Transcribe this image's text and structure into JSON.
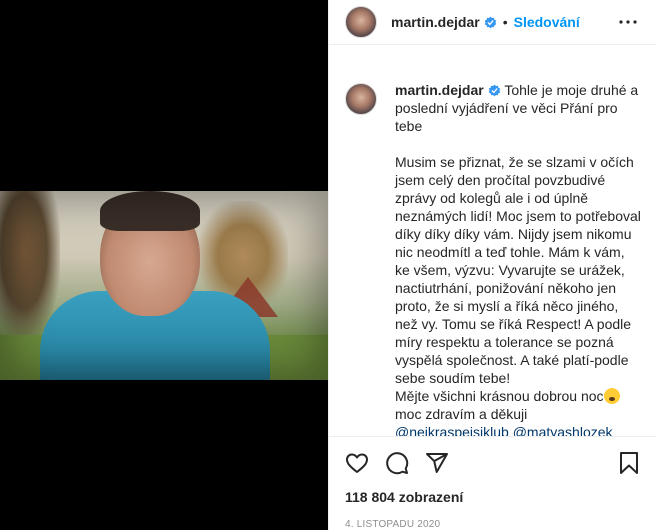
{
  "post": {
    "username": "martin.dejdar",
    "separator": "•",
    "follow_label": "Sledování",
    "caption_lines": [
      "Tohle je moje druhé a poslední vyjádření ve věci Přání pro tebe",
      "",
      "Musim se přiznat, že se slzami v očích jsem celý den pročítal povzbudivé zprávy od kolegů ale i od úplně neznámých lidí! Moc jsem to potřeboval díky díky díky vám. Nijdy jsem nikomu nic neodmítl a teď tohle. Mám k vám, ke všem, výzvu: Vyvarujte se urážek, nactiutrhání, ponižování někoho jen proto, že si myslí a říká něco jiného, než vy. Tomu se říká Respect! A podle míry respektu a tolerance se pozná vyspělá společnost. A také platí-podle sebe soudím tebe!",
      "Mějte všichni krásnou dobrou noc",
      "moc zdravím a děkuji"
    ],
    "mentions": "@nejkraspeisiklub @matyashlozek",
    "views": "118 804 zobrazení",
    "date": "4. LISTOPADU 2020"
  },
  "icons": {
    "verified": "verified-badge-icon",
    "more": "more-options-icon",
    "like": "heart-icon",
    "comment": "comment-icon",
    "share": "share-icon",
    "save": "bookmark-icon",
    "emoji": "sleepy-face-emoji-icon"
  },
  "colors": {
    "accent": "#0095f6",
    "verified": "#3897f0",
    "text": "#262626",
    "muted": "#8e8e8e",
    "mention": "#00376b"
  }
}
